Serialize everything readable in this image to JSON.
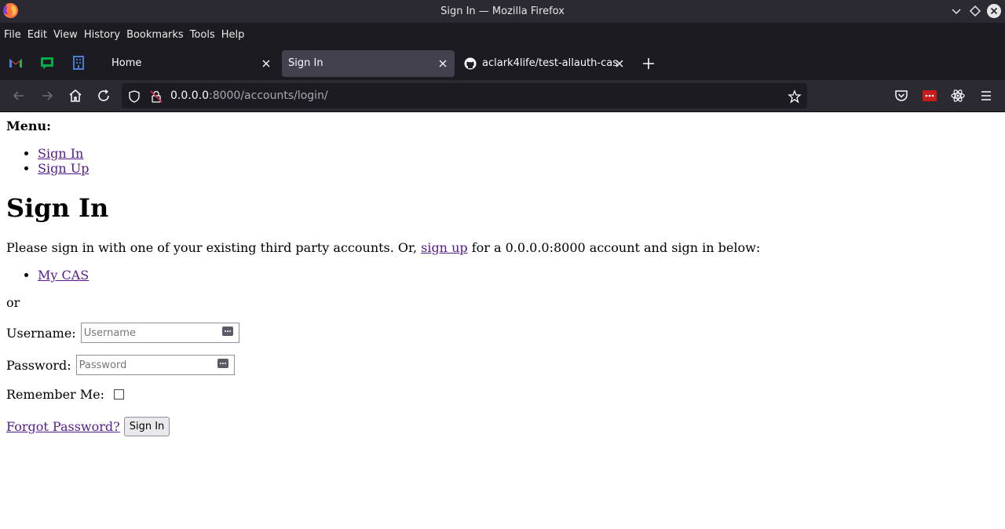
{
  "window": {
    "title": "Sign In — Mozilla Firefox"
  },
  "menubar": {
    "items": [
      "File",
      "Edit",
      "View",
      "History",
      "Bookmarks",
      "Tools",
      "Help"
    ]
  },
  "tabs": {
    "pinned": [
      {
        "icon": "gmail-icon"
      },
      {
        "icon": "google-chat-icon"
      },
      {
        "icon": "building-icon"
      }
    ],
    "items": [
      {
        "label": "Home",
        "active": false
      },
      {
        "label": "Sign In",
        "active": true
      },
      {
        "label": "aclark4life/test-allauth-cas",
        "active": false,
        "icon": "github-icon"
      }
    ]
  },
  "navbar": {
    "url_host": "0.0.0.0",
    "url_rest": ":8000/accounts/login/"
  },
  "page": {
    "menu_heading": "Menu:",
    "menu_links": [
      "Sign In",
      "Sign Up"
    ],
    "heading": "Sign In",
    "intro_before": "Please sign in with one of your existing third party accounts. Or, ",
    "intro_link": "sign up",
    "intro_after": " for a 0.0.0.0:8000 account and sign in below:",
    "providers": [
      "My CAS"
    ],
    "or_text": "or",
    "username_label": "Username:",
    "username_placeholder": "Username",
    "password_label": "Password:",
    "password_placeholder": "Password",
    "remember_label": "Remember Me:",
    "forgot_link": "Forgot Password?",
    "submit_label": "Sign In"
  },
  "colors": {
    "titlebar": "#2b2a33",
    "toolbar": "#1c1b22",
    "active_tab": "#42414d",
    "visited_link": "#551a8b"
  }
}
